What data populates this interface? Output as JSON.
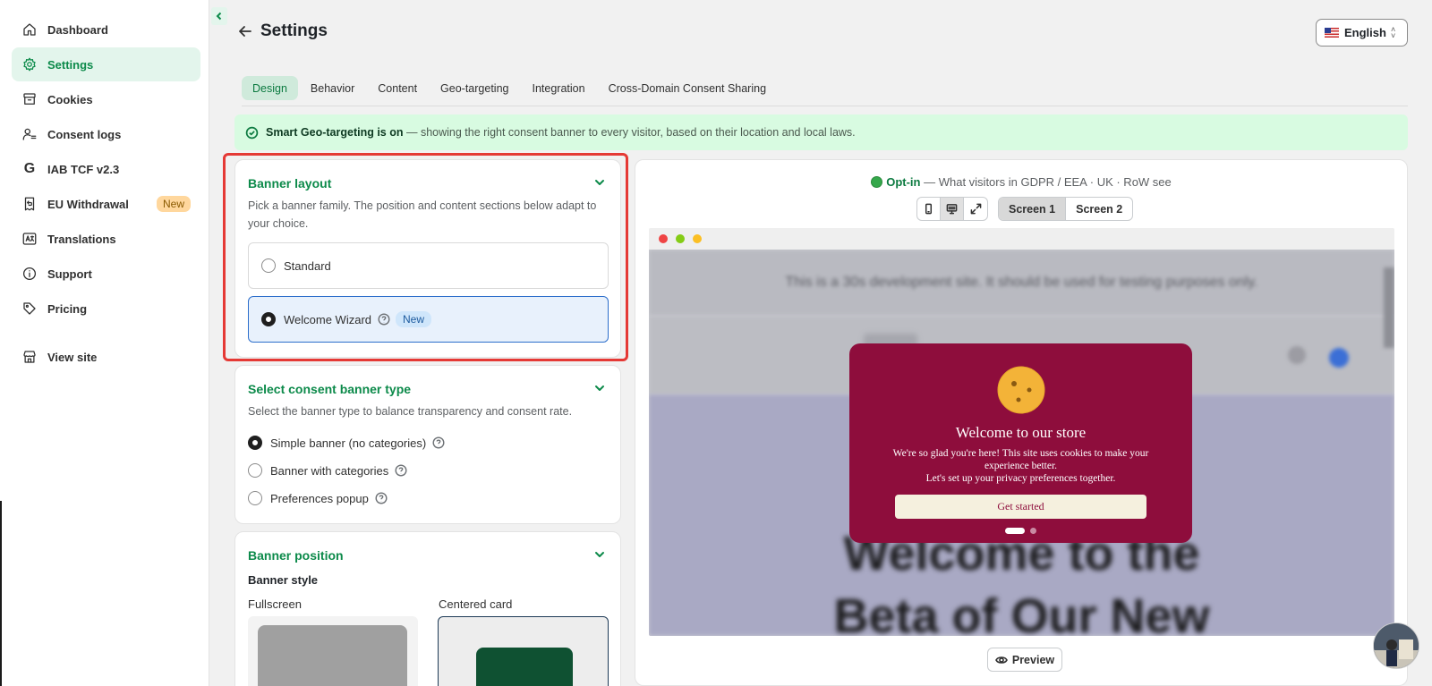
{
  "colors": {
    "brand_green": "#0c8a4a",
    "active_nav_bg": "#e3f5ec",
    "geo_banner_bg": "#d8fbe1",
    "modal_bg": "#8e0d3c",
    "modal_button_bg": "#f5f0de",
    "highlight_border": "#e53935",
    "selected_option_border": "#2c6ecb"
  },
  "sidebar": {
    "items": [
      {
        "label": "Dashboard",
        "icon": "home-icon"
      },
      {
        "label": "Settings",
        "icon": "gear-icon",
        "active": true
      },
      {
        "label": "Cookies",
        "icon": "archive-icon"
      },
      {
        "label": "Consent logs",
        "icon": "user-list-icon"
      },
      {
        "label": "IAB TCF v2.3",
        "icon": "google-g-icon"
      },
      {
        "label": "EU Withdrawal",
        "icon": "return-icon",
        "badge": "New"
      },
      {
        "label": "Translations",
        "icon": "translate-icon"
      },
      {
        "label": "Support",
        "icon": "info-icon"
      },
      {
        "label": "Pricing",
        "icon": "tag-icon"
      }
    ],
    "footer_item": {
      "label": "View site",
      "icon": "store-icon"
    }
  },
  "header": {
    "title": "Settings",
    "language": "English"
  },
  "tabs": [
    "Design",
    "Behavior",
    "Content",
    "Geo-targeting",
    "Integration",
    "Cross-Domain Consent Sharing"
  ],
  "active_tab": "Design",
  "geo_banner": {
    "bold": "Smart Geo-targeting is on",
    "text": " — showing the right consent banner to every visitor, based on their location and local laws."
  },
  "banner_layout": {
    "title": "Banner layout",
    "description": "Pick a banner family. The position and content sections below adapt to your choice.",
    "options": [
      {
        "label": "Standard",
        "selected": false
      },
      {
        "label": "Welcome Wizard",
        "selected": true,
        "badge": "New"
      }
    ]
  },
  "banner_type": {
    "title": "Select consent banner type",
    "description": "Select the banner type to balance transparency and consent rate.",
    "options": [
      {
        "label": "Simple banner (no categories)",
        "selected": true
      },
      {
        "label": "Banner with categories",
        "selected": false
      },
      {
        "label": "Preferences popup",
        "selected": false
      }
    ]
  },
  "banner_position": {
    "title": "Banner position",
    "style_heading": "Banner style",
    "styles": [
      {
        "label": "Fullscreen",
        "selected": false
      },
      {
        "label": "Centered card",
        "selected": true
      }
    ]
  },
  "preview": {
    "mode_label": "Opt-in",
    "mode_text": " — What visitors in GDPR / EEA · UK · RoW see",
    "screens": [
      "Screen 1",
      "Screen 2"
    ],
    "active_screen": "Screen 1",
    "site_notice": "This is a 30s development site. It should be used for testing purposes only.",
    "hero_line1": "Welcome to the",
    "hero_line2": "Beta of Our New",
    "modal": {
      "title": "Welcome to our store",
      "text_line1": "We're so glad you're here! This site uses cookies to make your experience better.",
      "text_line2": "Let's set up your privacy preferences together.",
      "button": "Get started",
      "pages": 2,
      "current_page": 1
    },
    "preview_button": "Preview"
  }
}
